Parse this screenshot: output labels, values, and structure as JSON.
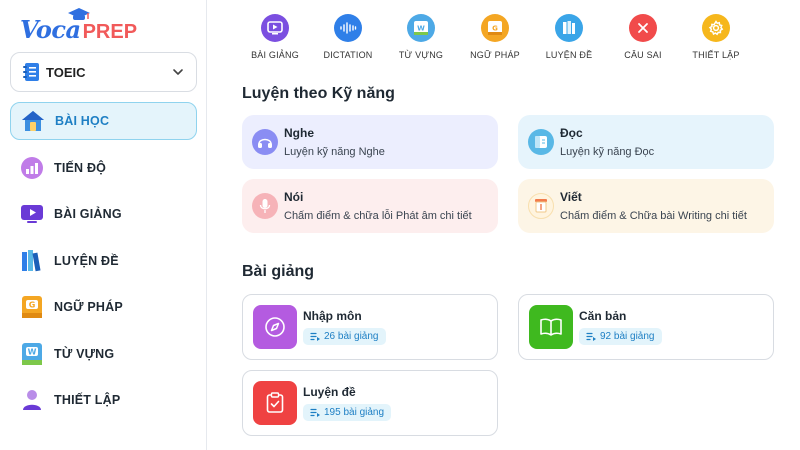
{
  "brand": {
    "part1": "Voca",
    "part2": "PREP"
  },
  "course_select": {
    "value": "TOEIC"
  },
  "sidebar": {
    "items": [
      {
        "label": "BÀI HỌC",
        "icon": "home-icon",
        "active": true
      },
      {
        "label": "TIẾN ĐỘ",
        "icon": "progress-chart-icon"
      },
      {
        "label": "BÀI GIẢNG",
        "icon": "video-icon"
      },
      {
        "label": "LUYỆN ĐỀ",
        "icon": "books-icon"
      },
      {
        "label": "NGỮ PHÁP",
        "icon": "grammar-book-icon"
      },
      {
        "label": "TỪ VỰNG",
        "icon": "vocabulary-book-icon"
      },
      {
        "label": "THIẾT LẬP",
        "icon": "user-settings-icon"
      }
    ]
  },
  "toolbar": {
    "items": [
      {
        "label": "BÀI GIẢNG",
        "icon": "video-icon",
        "color": "#7b4fe0"
      },
      {
        "label": "DICTATION",
        "icon": "audio-wave-icon",
        "color": "#2f7fe8"
      },
      {
        "label": "TỪ VỰNG",
        "icon": "word-book-icon",
        "color": "#4da9e6"
      },
      {
        "label": "NGỮ PHÁP",
        "icon": "grammar-book-icon",
        "color": "#f4a623"
      },
      {
        "label": "LUYỆN ĐỀ",
        "icon": "books-icon",
        "color": "#3aa5e8"
      },
      {
        "label": "CÂU SAI",
        "icon": "close-icon",
        "color": "#f14b4b"
      },
      {
        "label": "THIẾT LẬP",
        "icon": "gear-icon",
        "color": "#f6b71c"
      }
    ]
  },
  "skills": {
    "title": "Luyện theo Kỹ năng",
    "items": [
      {
        "title": "Nghe",
        "desc": "Luyện kỹ năng Nghe",
        "icon": "headphones-icon",
        "bg": "#eceefe",
        "icon_bg": "#8a8df3"
      },
      {
        "title": "Đọc",
        "desc": "Luyện kỹ năng Đọc",
        "icon": "reading-book-icon",
        "bg": "#e6f4fc",
        "icon_bg": "#59b8e6"
      },
      {
        "title": "Nói",
        "desc": "Chấm điểm & chữa lỗi Phát âm chi tiết",
        "icon": "microphone-icon",
        "bg": "#fdeeee",
        "icon_bg": "#f6b3b8"
      },
      {
        "title": "Viết",
        "desc": "Chấm điểm & Chữa bài Writing chi tiết",
        "icon": "writing-pen-icon",
        "bg": "#fdf5e6",
        "icon_bg": "#f8dfae"
      }
    ]
  },
  "lessons": {
    "title": "Bài giảng",
    "items": [
      {
        "title": "Nhập môn",
        "count": "26 bài giảng",
        "icon": "compass-icon",
        "icon_bg": "#b45be0"
      },
      {
        "title": "Căn bản",
        "count": "92 bài giảng",
        "icon": "open-book-icon",
        "icon_bg": "#3fb91f"
      },
      {
        "title": "Luyện đề",
        "count": "195 bài giảng",
        "icon": "clipboard-check-icon",
        "icon_bg": "#ef4242"
      }
    ]
  },
  "colors": {
    "accent": "#1e7fc4",
    "active_bg": "#e4f4fb",
    "active_border": "#8fd3ee"
  }
}
